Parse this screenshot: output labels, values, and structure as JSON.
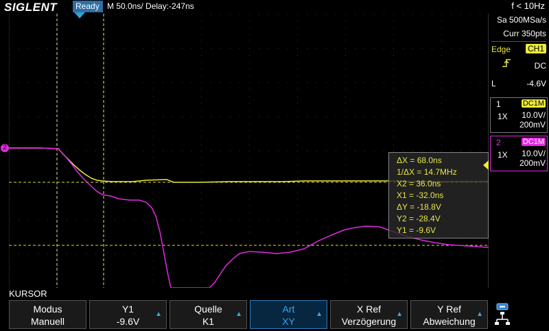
{
  "header": {
    "logo": "SIGLENT",
    "status": "Ready",
    "timebase": "M 50.0ns/",
    "delay": "Delay:-247ns",
    "freq": "f < 10Hz"
  },
  "acquisition": {
    "sample_rate": "Sa 500MSa/s",
    "points": "Curr 350pts"
  },
  "trigger": {
    "mode_label": "Edge",
    "source": "CH1",
    "coupling": "DC",
    "level_label": "L",
    "level": "-4.6V"
  },
  "channels": [
    {
      "num": "1",
      "coupling": "DC1M",
      "probe": "1X",
      "volts_div": "10.0V/",
      "offset": "200mV",
      "color": "#ecec3a"
    },
    {
      "num": "2",
      "coupling": "DC1M",
      "probe": "1X",
      "volts_div": "10.0V/",
      "offset": "200mV",
      "color": "#e22be2"
    }
  ],
  "cursor_readout": {
    "dx": "ΔX = 68.0ns",
    "inv_dx": "1/ΔX = 14.7MHz",
    "x2": "X2 = 36.0ns",
    "x1": "X1 = -32.0ns",
    "dy": "ΔY = -18.8V",
    "y2": "Y2 = -28.4V",
    "y1": "Y1 = -9.6V"
  },
  "menu": {
    "title": "KURSOR",
    "buttons": [
      {
        "l1": "Modus",
        "l2": "Manuell",
        "arrow": false,
        "active": false
      },
      {
        "l1": "Y1",
        "l2": "-9.6V",
        "arrow": true,
        "active": false
      },
      {
        "l1": "Quelle",
        "l2": "K1",
        "arrow": true,
        "active": false
      },
      {
        "l1": "Art",
        "l2": "XY",
        "arrow": true,
        "active": true
      },
      {
        "l1": "X Ref",
        "l2": "Verzögerung",
        "arrow": true,
        "active": false
      },
      {
        "l1": "Y Ref",
        "l2": "Abweichung",
        "arrow": true,
        "active": false
      }
    ]
  },
  "ch2_marker": "2",
  "colors": {
    "ch1": "#ecec3a",
    "ch2": "#e22be2",
    "accent": "#2ea3d6"
  }
}
